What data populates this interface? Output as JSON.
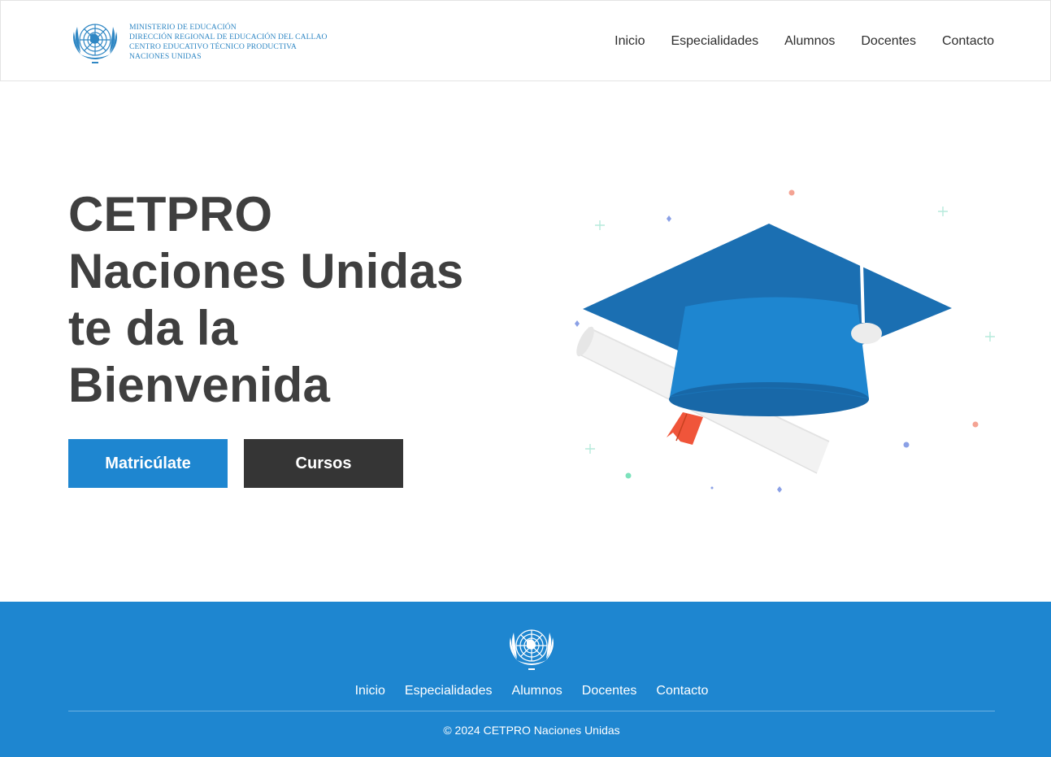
{
  "header": {
    "brand_lines": [
      "Ministerio de Educación",
      "Dirección Regional de Educación del Callao",
      "Centro Educativo Técnico Productiva",
      "Naciones Unidas"
    ],
    "nav": [
      "Inicio",
      "Especialidades",
      "Alumnos",
      "Docentes",
      "Contacto"
    ]
  },
  "hero": {
    "title_lines": [
      "CETPRO",
      "Naciones Unidas",
      "te da la",
      "Bienvenida"
    ],
    "primary_button": "Matricúlate",
    "secondary_button": "Cursos"
  },
  "footer": {
    "nav": [
      "Inicio",
      "Especialidades",
      "Alumnos",
      "Docentes",
      "Contacto"
    ],
    "copyright": "© 2024 CETPRO Naciones Unidas"
  },
  "colors": {
    "accent": "#1e86d0",
    "dark_button": "#353535",
    "heading": "#3f3f3f",
    "cap_dark": "#1b6fb2",
    "cap_light": "#1e86d0",
    "ribbon": "#f0553a"
  },
  "icons": [
    "un-emblem-icon",
    "graduation-cap-illustration",
    "diploma-scroll-icon"
  ]
}
